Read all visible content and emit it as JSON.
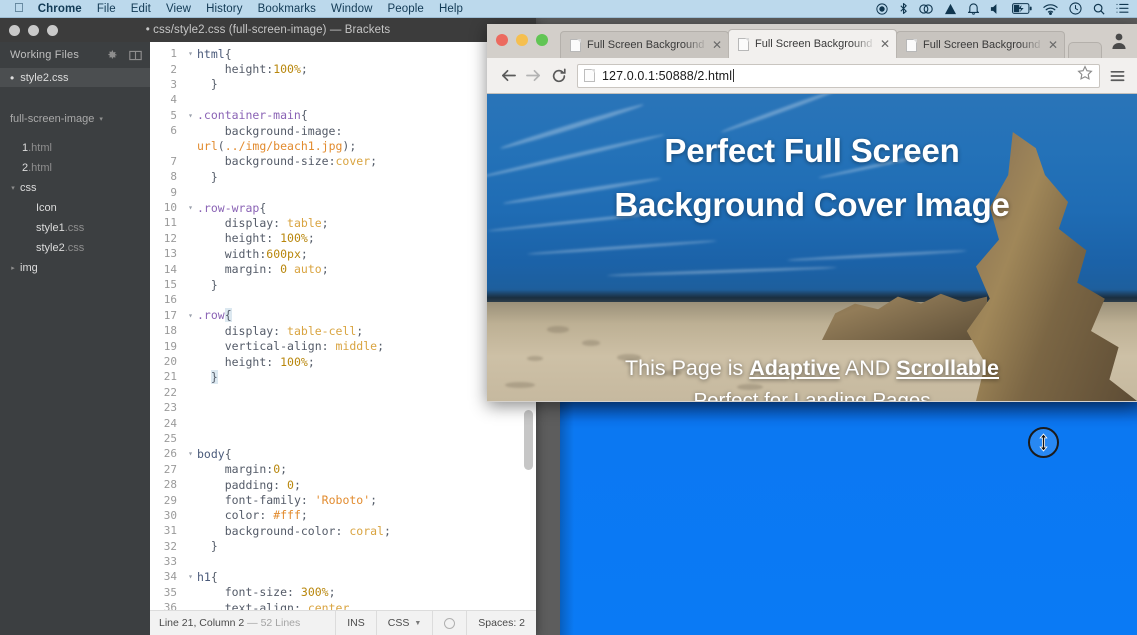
{
  "menubar": {
    "apple_icon": "apple-logo-icon",
    "items": [
      {
        "label": "Chrome",
        "bold": true
      },
      {
        "label": "File",
        "bold": false
      },
      {
        "label": "Edit",
        "bold": false
      },
      {
        "label": "View",
        "bold": false
      },
      {
        "label": "History",
        "bold": false
      },
      {
        "label": "Bookmarks",
        "bold": false
      },
      {
        "label": "Window",
        "bold": false
      },
      {
        "label": "People",
        "bold": false
      },
      {
        "label": "Help",
        "bold": false
      }
    ],
    "status_icons": [
      "screen-recording-icon",
      "bluetooth-icon",
      "creative-cloud-icon",
      "google-drive-icon",
      "notification-bell-icon",
      "volume-icon",
      "battery-charging-icon",
      "wifi-icon",
      "clock-icon",
      "spotlight-search-icon",
      "notification-center-icon"
    ]
  },
  "brackets": {
    "window_title": "• css/style2.css (full-screen-image) — Brackets",
    "traffic_lights": [
      "close-button",
      "minimize-button",
      "maximize-button"
    ],
    "sidebar": {
      "working_files_label": "Working Files",
      "gear_icon": "gear-icon",
      "split_icon": "split-view-icon",
      "open_file": "style2.css",
      "project_name": "full-screen-image",
      "tree": [
        {
          "name": "1",
          "ext": ".html",
          "indent": 1,
          "twisty": ""
        },
        {
          "name": "2",
          "ext": ".html",
          "indent": 1,
          "twisty": ""
        },
        {
          "name": "css",
          "ext": "",
          "indent": 0,
          "twisty": "▾"
        },
        {
          "name": "Icon",
          "ext": "",
          "indent": 2,
          "twisty": ""
        },
        {
          "name": "style1",
          "ext": ".css",
          "indent": 2,
          "twisty": ""
        },
        {
          "name": "style2",
          "ext": ".css",
          "indent": 2,
          "twisty": ""
        },
        {
          "name": "img",
          "ext": "",
          "indent": 0,
          "twisty": "▸"
        }
      ]
    },
    "code_lines": [
      {
        "n": "1",
        "fold": "▾",
        "html": "<span class=\"tok-tag\">html</span><span class=\"tok-punc\">{</span>"
      },
      {
        "n": "2",
        "fold": "",
        "html": "    <span class=\"tok-prop\">height</span><span class=\"tok-punc\">:</span><span class=\"tok-num\">100%</span><span class=\"tok-punc\">;</span>"
      },
      {
        "n": "3",
        "fold": "",
        "html": "  <span class=\"tok-punc\">}</span>"
      },
      {
        "n": "4",
        "fold": "",
        "html": ""
      },
      {
        "n": "5",
        "fold": "▾",
        "html": "<span class=\"tok-sel\">.container-main</span><span class=\"tok-punc\">{</span>"
      },
      {
        "n": "6",
        "fold": "",
        "html": "    <span class=\"tok-prop\">background-image</span><span class=\"tok-punc\">:</span>"
      },
      {
        "n": "",
        "fold": "",
        "html": "<span class=\"tok-url\">url</span><span class=\"tok-punc\">(</span><span class=\"tok-url\">../img/beach1.jpg</span><span class=\"tok-punc\">);</span>"
      },
      {
        "n": "7",
        "fold": "",
        "html": "    <span class=\"tok-prop\">background-size</span><span class=\"tok-punc\">:</span><span class=\"tok-val\">cover</span><span class=\"tok-punc\">;</span>"
      },
      {
        "n": "8",
        "fold": "",
        "html": "  <span class=\"tok-punc\">}</span>"
      },
      {
        "n": "9",
        "fold": "",
        "html": ""
      },
      {
        "n": "10",
        "fold": "▾",
        "html": "<span class=\"tok-sel\">.row-wrap</span><span class=\"tok-punc\">{</span>"
      },
      {
        "n": "11",
        "fold": "",
        "html": "    <span class=\"tok-prop\">display</span><span class=\"tok-punc\">:</span> <span class=\"tok-val\">table</span><span class=\"tok-punc\">;</span>"
      },
      {
        "n": "12",
        "fold": "",
        "html": "    <span class=\"tok-prop\">height</span><span class=\"tok-punc\">:</span> <span class=\"tok-num\">100%</span><span class=\"tok-punc\">;</span>"
      },
      {
        "n": "13",
        "fold": "",
        "html": "    <span class=\"tok-prop\">width</span><span class=\"tok-punc\">:</span><span class=\"tok-num\">600px</span><span class=\"tok-punc\">;</span>"
      },
      {
        "n": "14",
        "fold": "",
        "html": "    <span class=\"tok-prop\">margin</span><span class=\"tok-punc\">:</span> <span class=\"tok-num\">0</span> <span class=\"tok-val\">auto</span><span class=\"tok-punc\">;</span>"
      },
      {
        "n": "15",
        "fold": "",
        "html": "  <span class=\"tok-punc\">}</span>"
      },
      {
        "n": "16",
        "fold": "",
        "html": ""
      },
      {
        "n": "17",
        "fold": "▾",
        "html": "<span class=\"tok-sel\">.row</span><span class=\"tok-punc brace-hl\">{</span>"
      },
      {
        "n": "18",
        "fold": "",
        "html": "    <span class=\"tok-prop\">display</span><span class=\"tok-punc\">:</span> <span class=\"tok-val\">table-cell</span><span class=\"tok-punc\">;</span>"
      },
      {
        "n": "19",
        "fold": "",
        "html": "    <span class=\"tok-prop\">vertical-align</span><span class=\"tok-punc\">:</span> <span class=\"tok-val\">middle</span><span class=\"tok-punc\">;</span>"
      },
      {
        "n": "20",
        "fold": "",
        "html": "    <span class=\"tok-prop\">height</span><span class=\"tok-punc\">:</span> <span class=\"tok-num\">100%</span><span class=\"tok-punc\">;</span>"
      },
      {
        "n": "21",
        "fold": "",
        "html": "  <span class=\"tok-punc brace-hl\">}</span>"
      },
      {
        "n": "22",
        "fold": "",
        "html": ""
      },
      {
        "n": "23",
        "fold": "",
        "html": ""
      },
      {
        "n": "24",
        "fold": "",
        "html": ""
      },
      {
        "n": "25",
        "fold": "",
        "html": ""
      },
      {
        "n": "26",
        "fold": "▾",
        "html": "<span class=\"tok-tag\">body</span><span class=\"tok-punc\">{</span>"
      },
      {
        "n": "27",
        "fold": "",
        "html": "    <span class=\"tok-prop\">margin</span><span class=\"tok-punc\">:</span><span class=\"tok-num\">0</span><span class=\"tok-punc\">;</span>"
      },
      {
        "n": "28",
        "fold": "",
        "html": "    <span class=\"tok-prop\">padding</span><span class=\"tok-punc\">:</span> <span class=\"tok-num\">0</span><span class=\"tok-punc\">;</span>"
      },
      {
        "n": "29",
        "fold": "",
        "html": "    <span class=\"tok-prop\">font-family</span><span class=\"tok-punc\">:</span> <span class=\"tok-str\">'Roboto'</span><span class=\"tok-punc\">;</span>"
      },
      {
        "n": "30",
        "fold": "",
        "html": "    <span class=\"tok-prop\">color</span><span class=\"tok-punc\">:</span> <span class=\"tok-str\">#fff</span><span class=\"tok-punc\">;</span>"
      },
      {
        "n": "31",
        "fold": "",
        "html": "    <span class=\"tok-prop\">background-color</span><span class=\"tok-punc\">:</span> <span class=\"tok-val\">coral</span><span class=\"tok-punc\">;</span>"
      },
      {
        "n": "32",
        "fold": "",
        "html": "  <span class=\"tok-punc\">}</span>"
      },
      {
        "n": "33",
        "fold": "",
        "html": ""
      },
      {
        "n": "34",
        "fold": "▾",
        "html": "<span class=\"tok-tag\">h1</span><span class=\"tok-punc\">{</span>"
      },
      {
        "n": "35",
        "fold": "",
        "html": "    <span class=\"tok-prop\">font-size</span><span class=\"tok-punc\">:</span> <span class=\"tok-num\">300%</span><span class=\"tok-punc\">;</span>"
      },
      {
        "n": "36",
        "fold": "",
        "html": "    <span class=\"tok-prop\">text-align</span><span class=\"tok-punc\">:</span> <span class=\"tok-val\">center</span>"
      }
    ],
    "statusbar": {
      "cursor_position": "Line 21, Column 2",
      "line_count": "— 52 Lines",
      "insert_mode": "INS",
      "language": "CSS",
      "lint_icon": "lint-status-icon",
      "indent": "Spaces: 2"
    }
  },
  "chrome": {
    "traffic_lights": [
      "close-button",
      "minimize-button",
      "maximize-button"
    ],
    "tabs": [
      {
        "title": "Full Screen Background Cover Image",
        "active": false
      },
      {
        "title": "Full Screen Background Cover Image",
        "active": true
      },
      {
        "title": "Full Screen Background Cover Image",
        "active": false
      }
    ],
    "tab_close_glyph": "✕",
    "new_tab_label": "new-tab-button",
    "toolbar": {
      "back_icon": "back-arrow-icon",
      "forward_icon": "forward-arrow-icon",
      "reload_icon": "reload-icon",
      "url": "127.0.0.1:50888/2.html",
      "bookmark_icon": "star-icon",
      "menu_icon": "hamburger-menu-icon",
      "profile_icon": "profile-avatar-icon"
    },
    "page": {
      "headline_line1": "Perfect Full Screen",
      "headline_line2": "Background Cover Image",
      "sub_prefix": "This Page is ",
      "sub_bold1": "Adaptive",
      "sub_mid": " AND ",
      "sub_bold2": "Scrollable",
      "sub_line2": "Perfect for Landing Pages"
    }
  },
  "cursor": {
    "icon": "vertical-resize-cursor-icon"
  },
  "colors": {
    "menubar_bg": "#bcd9ec",
    "brackets_sidebar": "#3c3f41",
    "chrome_toolbar": "#f2f0ee",
    "page_blue": "#0a7af5"
  }
}
